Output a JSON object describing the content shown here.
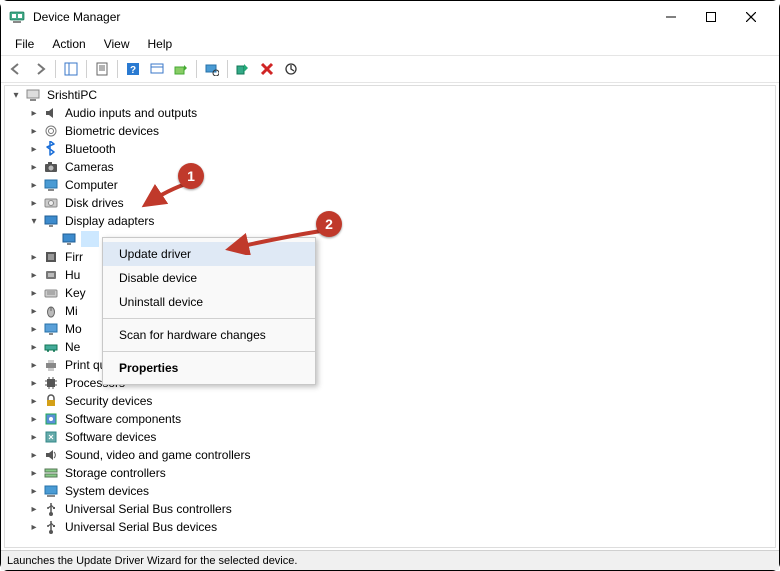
{
  "window": {
    "title": "Device Manager"
  },
  "menubar": [
    "File",
    "Action",
    "View",
    "Help"
  ],
  "root": "SrishtiPC",
  "tree": [
    {
      "label": "Audio inputs and outputs",
      "icon": "audio"
    },
    {
      "label": "Biometric devices",
      "icon": "biometric"
    },
    {
      "label": "Bluetooth",
      "icon": "bluetooth"
    },
    {
      "label": "Cameras",
      "icon": "camera"
    },
    {
      "label": "Computer",
      "icon": "computer"
    },
    {
      "label": "Disk drives",
      "icon": "disk"
    },
    {
      "label": "Display adapters",
      "icon": "display",
      "expanded": true,
      "selected_child": true
    },
    {
      "label": "Firr",
      "icon": "firmware"
    },
    {
      "label": "Hu",
      "icon": "hid"
    },
    {
      "label": "Key",
      "icon": "keyboard"
    },
    {
      "label": "Mi",
      "icon": "mouse"
    },
    {
      "label": "Mo",
      "icon": "monitor"
    },
    {
      "label": "Ne",
      "icon": "network"
    },
    {
      "label": "Print queues",
      "icon": "printer",
      "cut": true
    },
    {
      "label": "Processors",
      "icon": "cpu"
    },
    {
      "label": "Security devices",
      "icon": "security"
    },
    {
      "label": "Software components",
      "icon": "softcomp"
    },
    {
      "label": "Software devices",
      "icon": "softdev"
    },
    {
      "label": "Sound, video and game controllers",
      "icon": "sound"
    },
    {
      "label": "Storage controllers",
      "icon": "storage"
    },
    {
      "label": "System devices",
      "icon": "system"
    },
    {
      "label": "Universal Serial Bus controllers",
      "icon": "usb"
    },
    {
      "label": "Universal Serial Bus devices",
      "icon": "usb"
    }
  ],
  "context_menu": {
    "update": "Update driver",
    "disable": "Disable device",
    "uninstall": "Uninstall device",
    "scan": "Scan for hardware changes",
    "properties": "Properties"
  },
  "statusbar": "Launches the Update Driver Wizard for the selected device.",
  "callouts": {
    "c1": "1",
    "c2": "2"
  }
}
